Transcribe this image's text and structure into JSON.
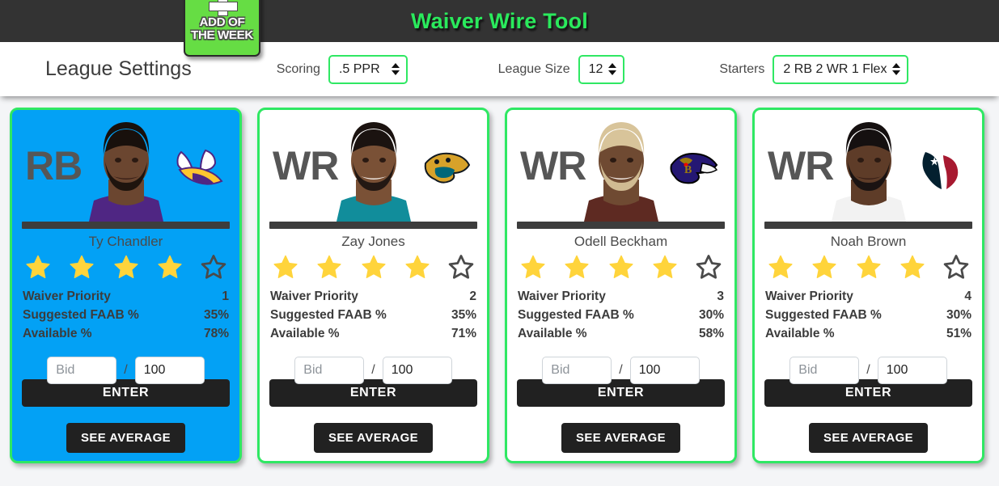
{
  "header": {
    "title": "Waiver Wire Tool",
    "title_color": "#2aea5c",
    "background_color": "#333333"
  },
  "settings": {
    "title": "League Settings",
    "accent_color": "#2fe863",
    "controls": [
      {
        "label": "Scoring",
        "value": ".5 PPR"
      },
      {
        "label": "League Size",
        "value": "12"
      },
      {
        "label": "Starters",
        "value": "2 RB 2 WR 1 Flex"
      }
    ]
  },
  "badge": {
    "line1": "ADD OF",
    "line2": "THE WEEK",
    "icon": "plus-icon",
    "color": "#66dd44"
  },
  "labels": {
    "waiver_priority": "Waiver Priority",
    "suggested_faab": "Suggested FAAB %",
    "available": "Available %",
    "bid_placeholder": "Bid",
    "slash": "/",
    "enter": "ENTER",
    "see_average": "SEE AVERAGE"
  },
  "cards": [
    {
      "position": "RB",
      "name": "Ty Chandler",
      "team": "Minnesota Vikings",
      "team_logo": "vikings-logo",
      "featured": true,
      "card_background": "#03a1f5",
      "stars_filled": 4,
      "stars_total": 5,
      "waiver_priority": "1",
      "suggested_faab": "35%",
      "available": "78%",
      "bid_value": "",
      "budget_value": "100"
    },
    {
      "position": "WR",
      "name": "Zay Jones",
      "team": "Jacksonville Jaguars",
      "team_logo": "jaguars-logo",
      "featured": false,
      "card_background": "#ffffff",
      "stars_filled": 4,
      "stars_total": 5,
      "waiver_priority": "2",
      "suggested_faab": "35%",
      "available": "71%",
      "bid_value": "",
      "budget_value": "100"
    },
    {
      "position": "WR",
      "name": "Odell Beckham",
      "team": "Baltimore Ravens",
      "team_logo": "ravens-logo",
      "featured": false,
      "card_background": "#ffffff",
      "stars_filled": 4,
      "stars_total": 5,
      "waiver_priority": "3",
      "suggested_faab": "30%",
      "available": "58%",
      "bid_value": "",
      "budget_value": "100"
    },
    {
      "position": "WR",
      "name": "Noah Brown",
      "team": "Houston Texans",
      "team_logo": "texans-logo",
      "featured": false,
      "card_background": "#ffffff",
      "stars_filled": 4,
      "stars_total": 5,
      "waiver_priority": "4",
      "suggested_faab": "30%",
      "available": "51%",
      "bid_value": "",
      "budget_value": "100"
    }
  ]
}
